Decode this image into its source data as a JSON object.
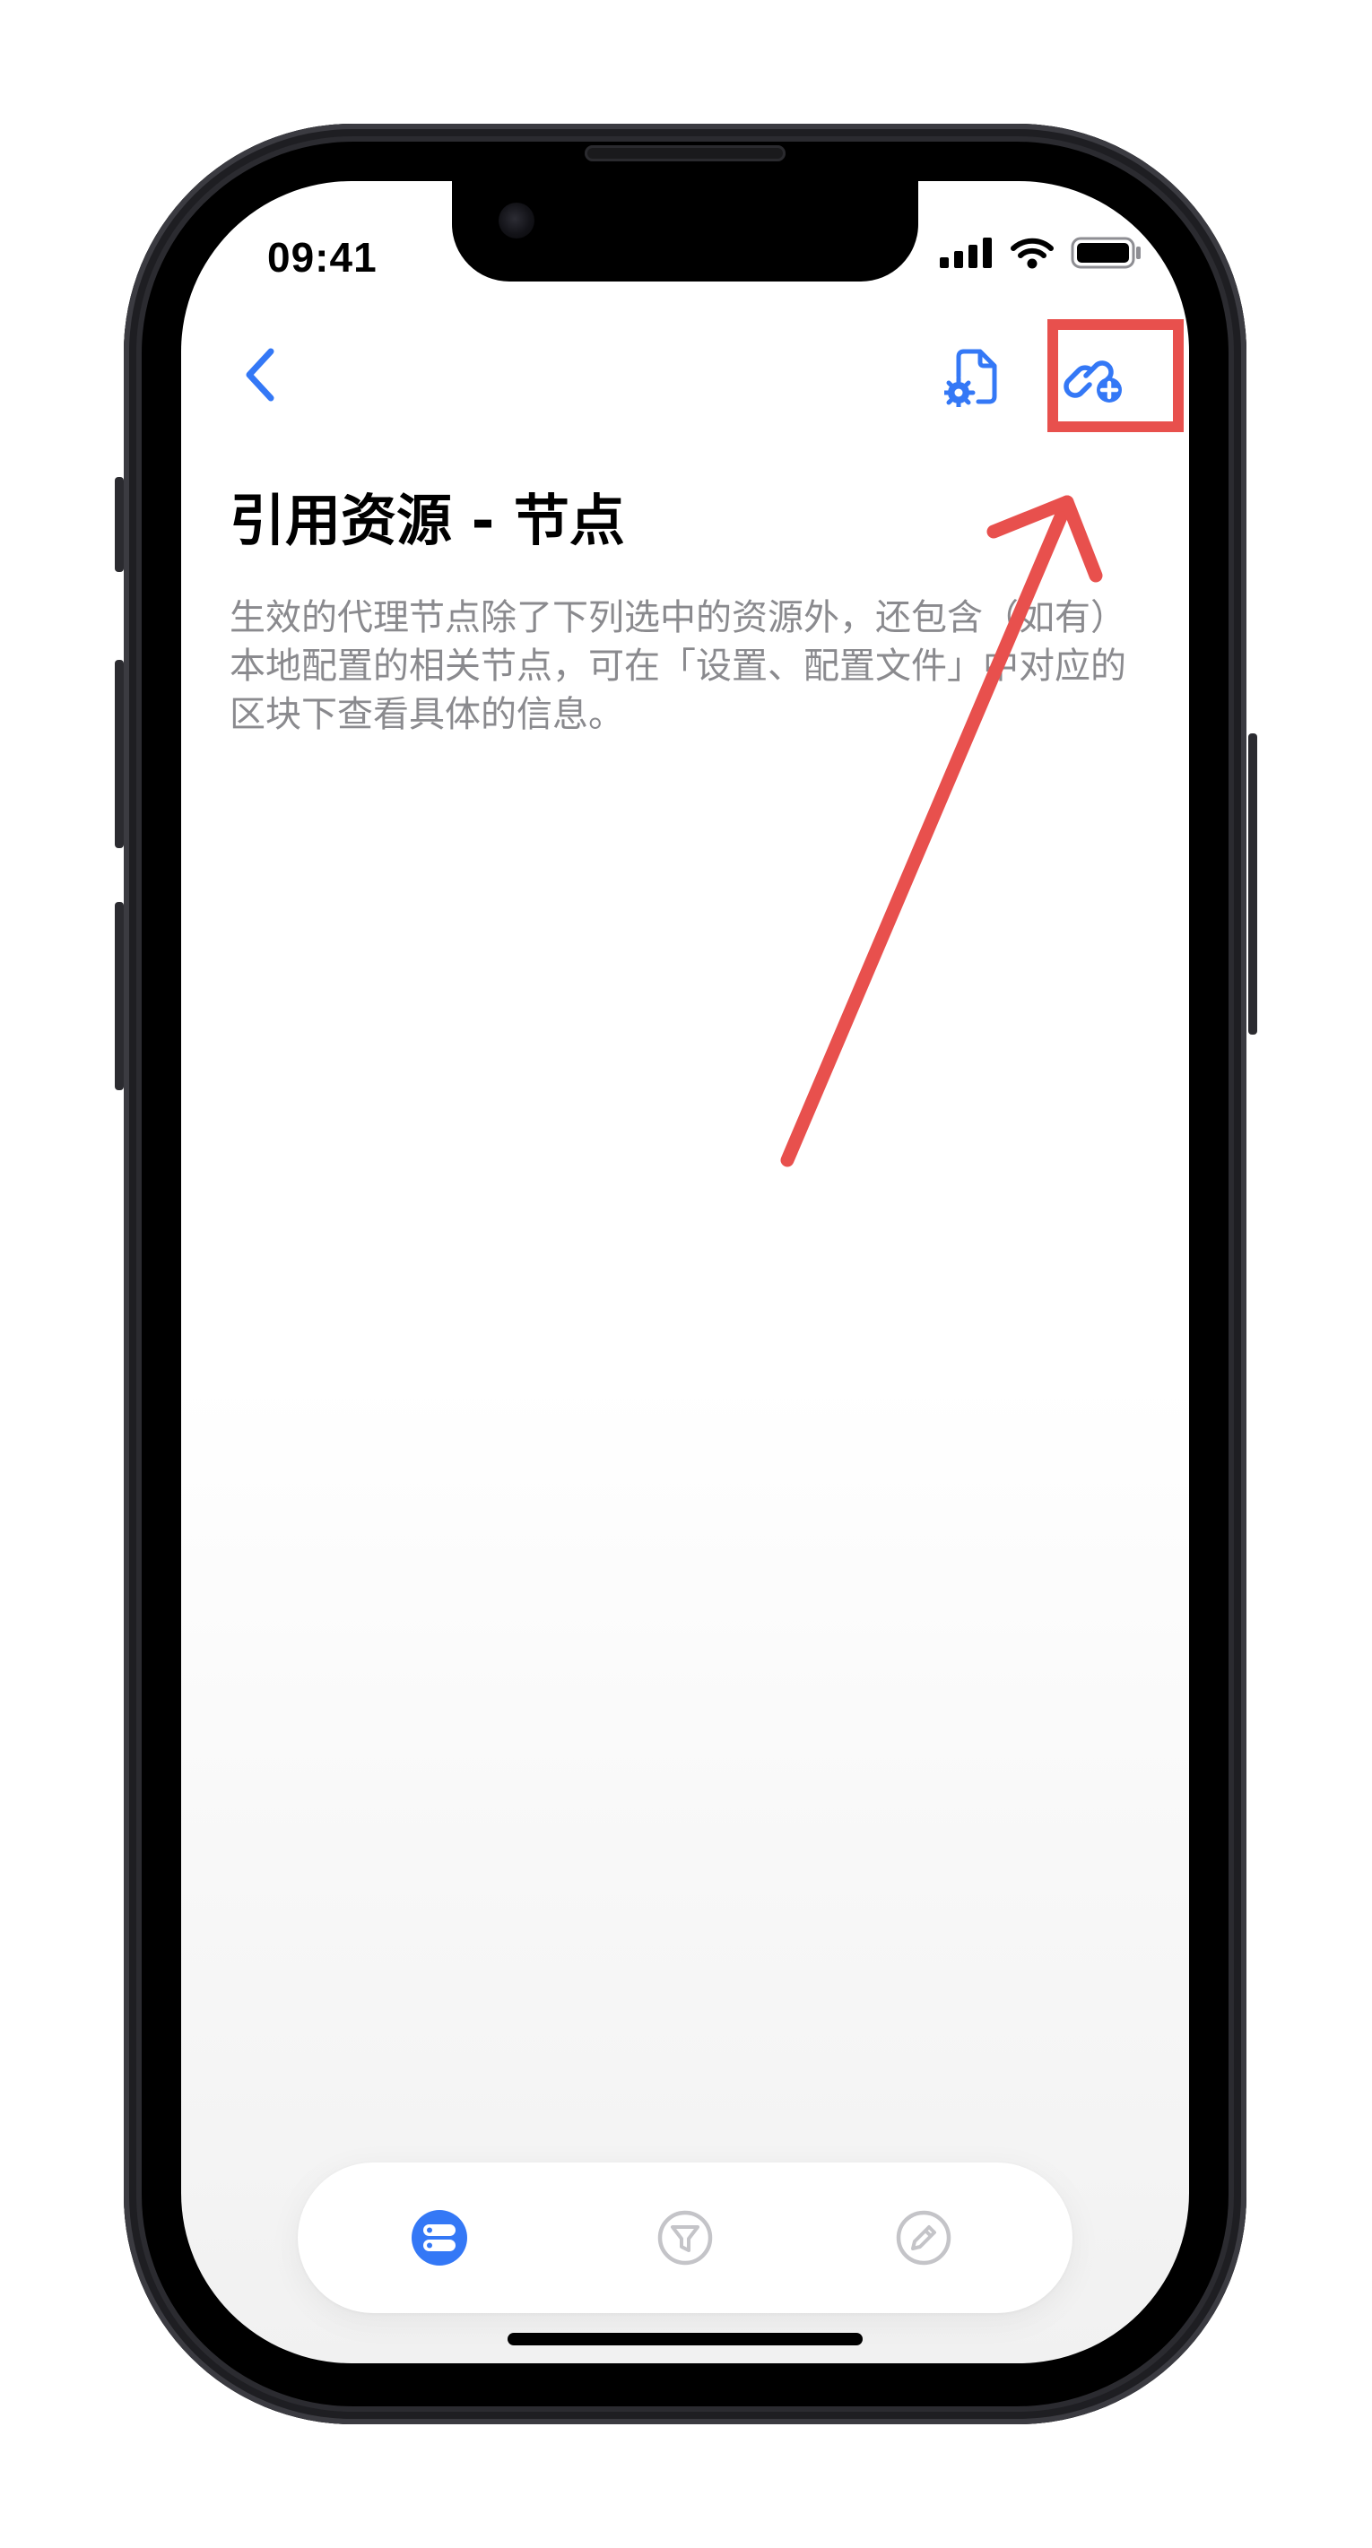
{
  "status_bar": {
    "time": "09:41"
  },
  "nav_bar": {
    "back_icon": "chevron-left-icon",
    "config_icon": "document-gear-icon",
    "add_link_icon": "link-plus-icon"
  },
  "page": {
    "title": "引用资源 - 节点",
    "description": "生效的代理节点除了下列选中的资源外，还包含（如有）本地配置的相关节点，可在「设置、配置文件」中对应的区块下查看具体的信息。"
  },
  "tab_bar": {
    "tabs": [
      {
        "icon": "server-stack-icon",
        "selected": true
      },
      {
        "icon": "filter-icon",
        "selected": false
      },
      {
        "icon": "pencil-icon",
        "selected": false
      }
    ]
  },
  "colors": {
    "accent": "#3478f6",
    "title_text": "#000000",
    "secondary_text": "#8a8a8e",
    "inactive_icon": "#c4c4c8",
    "annotation": "#e8504d",
    "device_frame": "#2b2b30"
  },
  "annotations": {
    "highlight_target": "link-plus-icon",
    "arrow": true
  }
}
